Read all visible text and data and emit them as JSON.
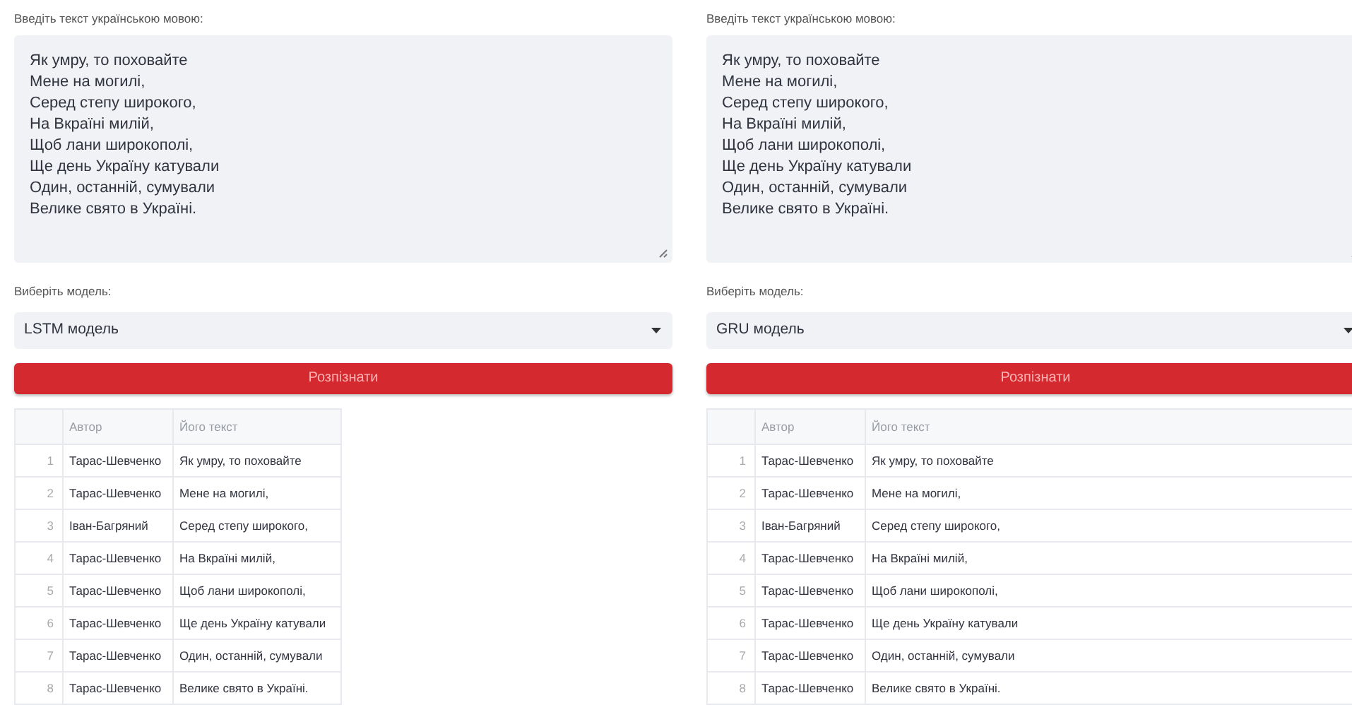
{
  "panels": [
    {
      "text_label": "Введіть текст українською мовою:",
      "text_value": "Як умру, то поховайте\nМене на могилі,\nСеред степу широкого,\nНа Вкраїні милій,\nЩоб лани широкополі,\nЩе день Україну катували\nОдин, останній, сумували\nВелике свято в Україні.",
      "model_label": "Виберіть модель:",
      "model_value": "LSTM модель",
      "button": "Розпізнати",
      "table_stretched": false,
      "table": {
        "columns": [
          "Автор",
          "Його текст"
        ],
        "rows": [
          {
            "index": "1",
            "author": "Тарас-Шевченко",
            "text": "Як умру, то поховайте"
          },
          {
            "index": "2",
            "author": "Тарас-Шевченко",
            "text": "Мене на могилі,"
          },
          {
            "index": "3",
            "author": "Іван-Багряний",
            "text": "Серед степу широкого,"
          },
          {
            "index": "4",
            "author": "Тарас-Шевченко",
            "text": "На Вкраїні милій,"
          },
          {
            "index": "5",
            "author": "Тарас-Шевченко",
            "text": "Щоб лани широкополі,"
          },
          {
            "index": "6",
            "author": "Тарас-Шевченко",
            "text": "Ще день Україну катували"
          },
          {
            "index": "7",
            "author": "Тарас-Шевченко",
            "text": "Один, останній, сумували"
          },
          {
            "index": "8",
            "author": "Тарас-Шевченко",
            "text": "Велике свято в Україні."
          }
        ]
      }
    },
    {
      "text_label": "Введіть текст українською мовою:",
      "text_value": "Як умру, то поховайте\nМене на могилі,\nСеред степу широкого,\nНа Вкраїні милій,\nЩоб лани широкополі,\nЩе день Україну катували\nОдин, останній, сумували\nВелике свято в Україні.",
      "model_label": "Виберіть модель:",
      "model_value": "GRU модель",
      "button": "Розпізнати",
      "table_stretched": true,
      "table": {
        "columns": [
          "Автор",
          "Його текст"
        ],
        "rows": [
          {
            "index": "1",
            "author": "Тарас-Шевченко",
            "text": "Як умру, то поховайте"
          },
          {
            "index": "2",
            "author": "Тарас-Шевченко",
            "text": "Мене на могилі,"
          },
          {
            "index": "3",
            "author": "Іван-Багряний",
            "text": "Серед степу широкого,"
          },
          {
            "index": "4",
            "author": "Тарас-Шевченко",
            "text": "На Вкраїні милій,"
          },
          {
            "index": "5",
            "author": "Тарас-Шевченко",
            "text": "Щоб лани широкополі,"
          },
          {
            "index": "6",
            "author": "Тарас-Шевченко",
            "text": "Ще день Україну катували"
          },
          {
            "index": "7",
            "author": "Тарас-Шевченко",
            "text": "Один, останній, сумували"
          },
          {
            "index": "8",
            "author": "Тарас-Шевченко",
            "text": "Велике свято в Україні."
          }
        ]
      }
    }
  ]
}
